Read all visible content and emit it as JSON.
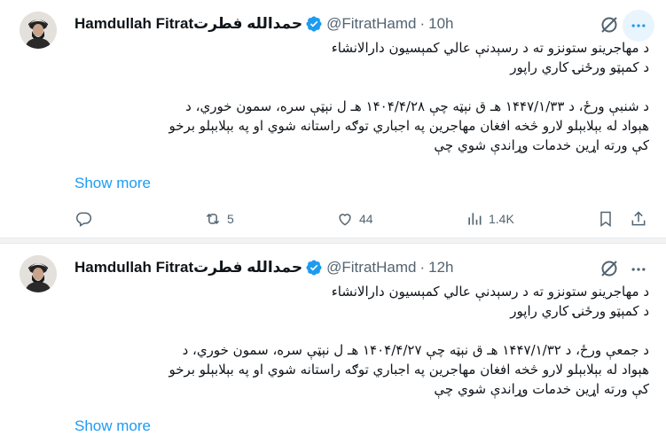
{
  "tweets": [
    {
      "author_name": "Hamdullah Fitrat",
      "author_name_ps": "حمدالله فطرت",
      "handle": "@FitratHamd",
      "separator": "·",
      "time": "10h",
      "lines": [
        "د مهاجرینو ستونزو ته د رسېدنې عالي کمېسیون دارالانشاء",
        "د کمېټو ورځنۍ کاري راپور",
        "",
        "د شنبې ورځ، د ۱۴۴۷/۱/۳۳ هـ ق نېټه چې ۱۴۰۴/۴/۲۸ هـ ل نېټې سره، سمون خوري، د",
        "هېواد له بېلابېلو لارو څخه افغان مهاجرین په اجباري توګه راستانه شوي او په بېلابېلو برخو",
        "کې ورته اړین خدمات وړاندې شوي چې"
      ],
      "show_more": "Show more",
      "stats": {
        "replies": "",
        "reposts": "5",
        "likes": "44",
        "views": "1.4K"
      }
    },
    {
      "author_name": "Hamdullah Fitrat",
      "author_name_ps": "حمدالله فطرت",
      "handle": "@FitratHamd",
      "separator": "·",
      "time": "12h",
      "lines": [
        "د مهاجرینو ستونزو ته د رسېدنې عالي کمېسیون دارالانشاء",
        "د کمېټو ورځنۍ کاري راپور",
        "",
        "د جمعې ورځ، د ۱۴۴۷/۱/۳۲ هـ ق نېټه چې ۱۴۰۴/۴/۲۷ هـ ل نېټې سره، سمون خوري، د",
        "هېواد له بېلابېلو لارو څخه افغان مهاجرین په اجباري توګه راستانه شوي او په بېلابېلو برخو",
        "کې ورته اړین خدمات وړاندې شوي چې"
      ],
      "show_more": "Show more"
    }
  ],
  "icons": {
    "verified": "verified-badge-icon",
    "grok": "grok-icon",
    "more": "more-dots-icon",
    "reply": "reply-icon",
    "repost": "repost-icon",
    "like": "heart-icon",
    "views": "analytics-icon",
    "bookmark": "bookmark-icon",
    "share": "share-icon"
  },
  "colors": {
    "accent": "#1d9bf0",
    "secondary_text": "#536471",
    "text": "#0f1419"
  }
}
